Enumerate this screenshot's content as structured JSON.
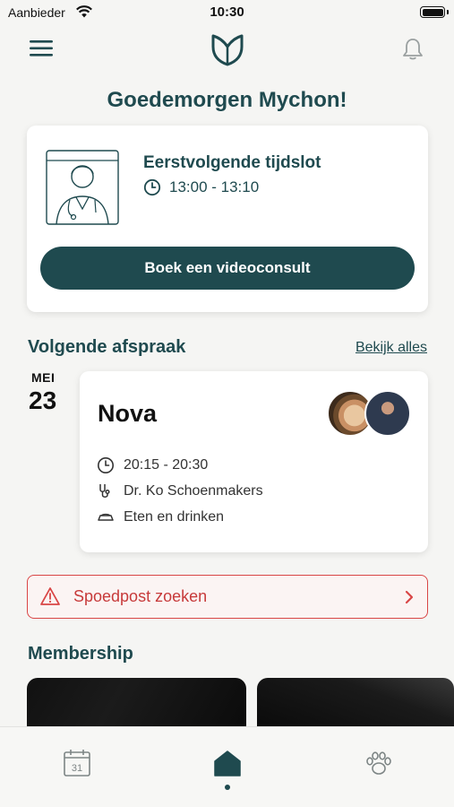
{
  "status_bar": {
    "carrier": "Aanbieder",
    "time": "10:30"
  },
  "greeting": "Goedemorgen Mychon!",
  "next_slot": {
    "title": "Eerstvolgende tijdslot",
    "time": "13:00 - 13:10",
    "book_label": "Boek een videoconsult"
  },
  "appointments": {
    "section_title": "Volgende afspraak",
    "see_all_label": "Bekijk alles",
    "date_month": "MEI",
    "date_day": "23",
    "pet_name": "Nova",
    "time": "20:15 - 20:30",
    "vet": "Dr. Ko Schoenmakers",
    "reason": "Eten en drinken"
  },
  "emergency": {
    "label": "Spoedpost zoeken"
  },
  "membership": {
    "section_title": "Membership"
  },
  "tabs": [
    {
      "icon": "calendar-icon",
      "label": "31"
    },
    {
      "icon": "home-icon",
      "active": true
    },
    {
      "icon": "paw-icon"
    }
  ],
  "colors": {
    "primary": "#1f4a4f",
    "background": "#f5f5f3",
    "danger": "#d94646"
  }
}
